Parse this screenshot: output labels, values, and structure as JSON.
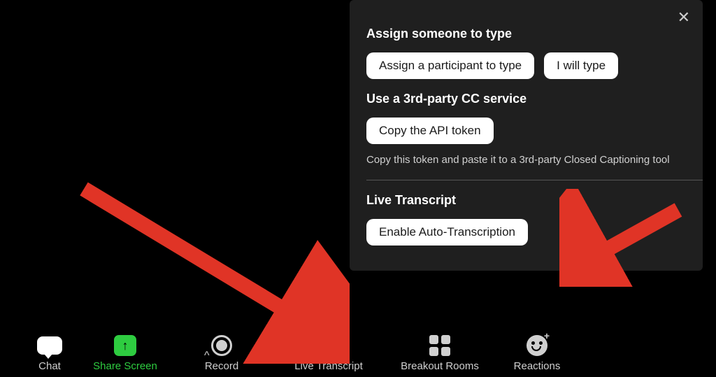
{
  "popup": {
    "section1_title": "Assign someone to type",
    "assign_btn": "Assign a participant to type",
    "i_will_type_btn": "I will type",
    "section2_title": "Use a 3rd-party CC service",
    "copy_token_btn": "Copy the API token",
    "copy_helper": "Copy this token and paste it to a 3rd-party Closed Captioning tool",
    "section3_title": "Live Transcript",
    "enable_auto_btn": "Enable Auto-Transcription"
  },
  "toolbar": {
    "chat": "Chat",
    "share_screen": "Share Screen",
    "record": "Record",
    "live_transcript": "Live Transcript",
    "breakout_rooms": "Breakout Rooms",
    "reactions": "Reactions"
  }
}
